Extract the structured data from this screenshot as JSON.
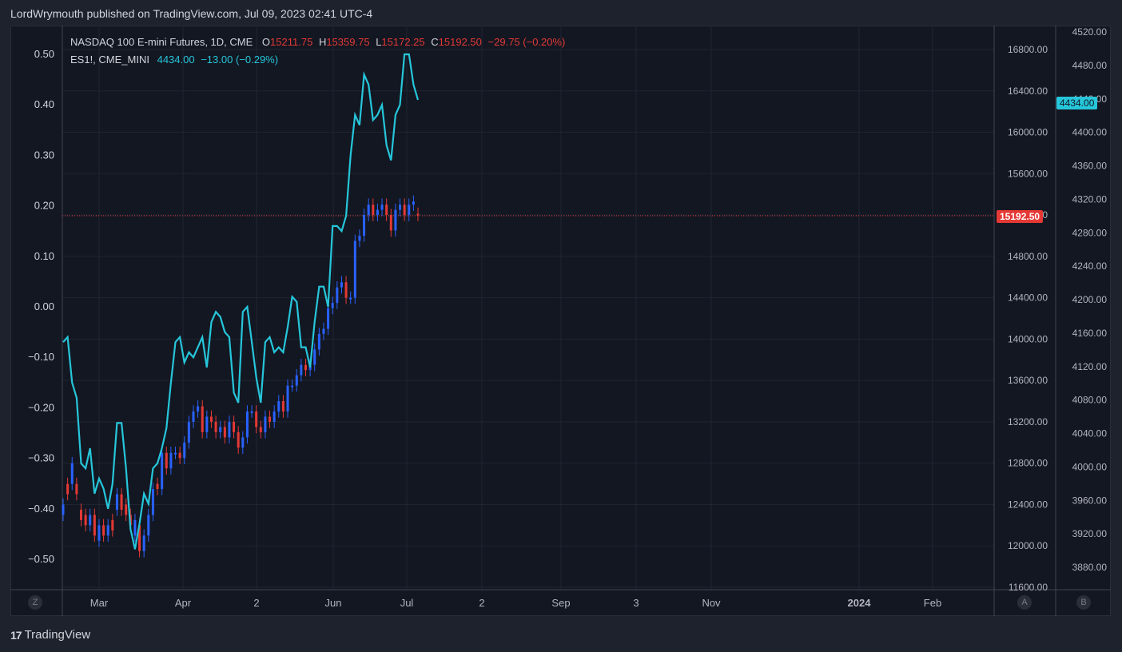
{
  "header": {
    "published": "LordWrymouth published on TradingView.com, Jul 09, 2023 02:41 UTC-4"
  },
  "legend": {
    "main": {
      "symbol": "NASDAQ 100 E-mini Futures, 1D, CME",
      "o_label": "O",
      "o": "15211.75",
      "h_label": "H",
      "h": "15359.75",
      "l_label": "L",
      "l": "15172.25",
      "c_label": "C",
      "c": "15192.50",
      "change": "−29.75 (−0.20%)"
    },
    "compare": {
      "symbol": "ES1!, CME_MINI",
      "value": "4434.00",
      "change": "−13.00 (−0.29%)"
    }
  },
  "badges": {
    "last_price": "15192.50",
    "compare_price": "4434.00"
  },
  "corners": {
    "left": "Z",
    "mid": "A",
    "right": "B"
  },
  "footer": {
    "brand": "TradingView",
    "logo": "17"
  },
  "colors": {
    "up": "#2962ff",
    "down": "#e53935",
    "line": "#26c6da",
    "bg": "#131722"
  },
  "chart_data": {
    "type": "line",
    "x_ticks": [
      "Mar",
      "Apr",
      "2",
      "Jun",
      "Jul",
      "2",
      "Sep",
      "3",
      "Nov",
      "2024",
      "Feb"
    ],
    "left_axis": {
      "ticks": [
        "0.50",
        "0.40",
        "0.30",
        "0.20",
        "0.10",
        "0.00",
        "−0.10",
        "−0.20",
        "−0.30",
        "−0.40",
        "−0.50"
      ],
      "ylim": [
        -0.55,
        0.58
      ]
    },
    "right_axis_nq": {
      "ticks": [
        "16800.00",
        "16400.00",
        "16000.00",
        "15600.00",
        "15200.00",
        "14800.00",
        "14400.00",
        "14000.00",
        "13600.00",
        "13200.00",
        "12800.00",
        "12400.00",
        "12000.00",
        "11600.00"
      ]
    },
    "right_axis_es": {
      "ticks": [
        "4520.00",
        "4480.00",
        "4440.00",
        "4400.00",
        "4360.00",
        "4320.00",
        "4280.00",
        "4240.00",
        "4200.00",
        "4160.00",
        "4120.00",
        "4080.00",
        "4040.00",
        "4000.00",
        "3960.00",
        "3920.00",
        "3880.00"
      ]
    },
    "last_price_line": 15192.5,
    "series": [
      {
        "name": "ES1!, CME_MINI",
        "color": "#26c6da",
        "values": [
          -0.07,
          -0.06,
          -0.15,
          -0.18,
          -0.31,
          -0.32,
          -0.28,
          -0.37,
          -0.34,
          -0.36,
          -0.4,
          -0.35,
          -0.23,
          -0.23,
          -0.32,
          -0.44,
          -0.48,
          -0.43,
          -0.37,
          -0.39,
          -0.32,
          -0.31,
          -0.28,
          -0.24,
          -0.15,
          -0.07,
          -0.06,
          -0.11,
          -0.09,
          -0.1,
          -0.08,
          -0.06,
          -0.12,
          -0.03,
          -0.01,
          -0.02,
          -0.05,
          -0.06,
          -0.17,
          -0.19,
          -0.01,
          0.0,
          -0.07,
          -0.14,
          -0.19,
          -0.07,
          -0.06,
          -0.09,
          -0.08,
          -0.09,
          -0.04,
          0.02,
          0.01,
          -0.08,
          -0.08,
          -0.12,
          -0.03,
          0.04,
          0.04,
          0.0,
          0.16,
          0.16,
          0.15,
          0.18,
          0.3,
          0.38,
          0.36,
          0.46,
          0.44,
          0.37,
          0.38,
          0.4,
          0.32,
          0.29,
          0.38,
          0.4,
          0.5,
          0.5,
          0.44,
          0.41
        ]
      },
      {
        "name": "NASDAQ 100 E-mini Futures",
        "type": "candlestick",
        "close": [
          12400,
          12500,
          12800,
          12500,
          12250,
          12200,
          12300,
          12100,
          12200,
          12100,
          12200,
          12150,
          12500,
          12350,
          12300,
          12200,
          12250,
          11950,
          12100,
          12300,
          12550,
          12550,
          12900,
          12750,
          12900,
          12900,
          12850,
          13000,
          13200,
          13300,
          13350,
          13100,
          13250,
          13200,
          13100,
          13150,
          13050,
          13200,
          13100,
          12950,
          13050,
          13300,
          13300,
          13150,
          13100,
          13250,
          13200,
          13300,
          13400,
          13300,
          13550,
          13550,
          13650,
          13750,
          13700,
          13750,
          13900,
          14050,
          14100,
          14300,
          14350,
          14500,
          14550,
          14400,
          14400,
          14950,
          15000,
          15200,
          15300,
          15200,
          15250,
          15300,
          15200,
          15050,
          15250,
          15300,
          15200,
          15300,
          15330,
          15200
        ],
        "open": [
          12300,
          12600,
          12600,
          12600,
          12350,
          12300,
          12200,
          12300,
          12050,
          12200,
          12100,
          12250,
          12350,
          12500,
          12400,
          12300,
          12100,
          12200,
          11950,
          12100,
          12300,
          12600,
          12550,
          12900,
          12750,
          12900,
          12900,
          12850,
          13000,
          13200,
          13300,
          13350,
          13100,
          13250,
          13200,
          13100,
          13150,
          13050,
          13200,
          13100,
          12950,
          13050,
          13300,
          13300,
          13150,
          13100,
          13250,
          13200,
          13300,
          13400,
          13300,
          13550,
          13550,
          13650,
          13750,
          13700,
          13750,
          13900,
          14050,
          14100,
          14300,
          14350,
          14500,
          14550,
          14400,
          14400,
          14950,
          15000,
          15200,
          15300,
          15200,
          15250,
          15300,
          15200,
          15050,
          15250,
          15300,
          15200,
          15300,
          15211.75
        ]
      }
    ]
  }
}
